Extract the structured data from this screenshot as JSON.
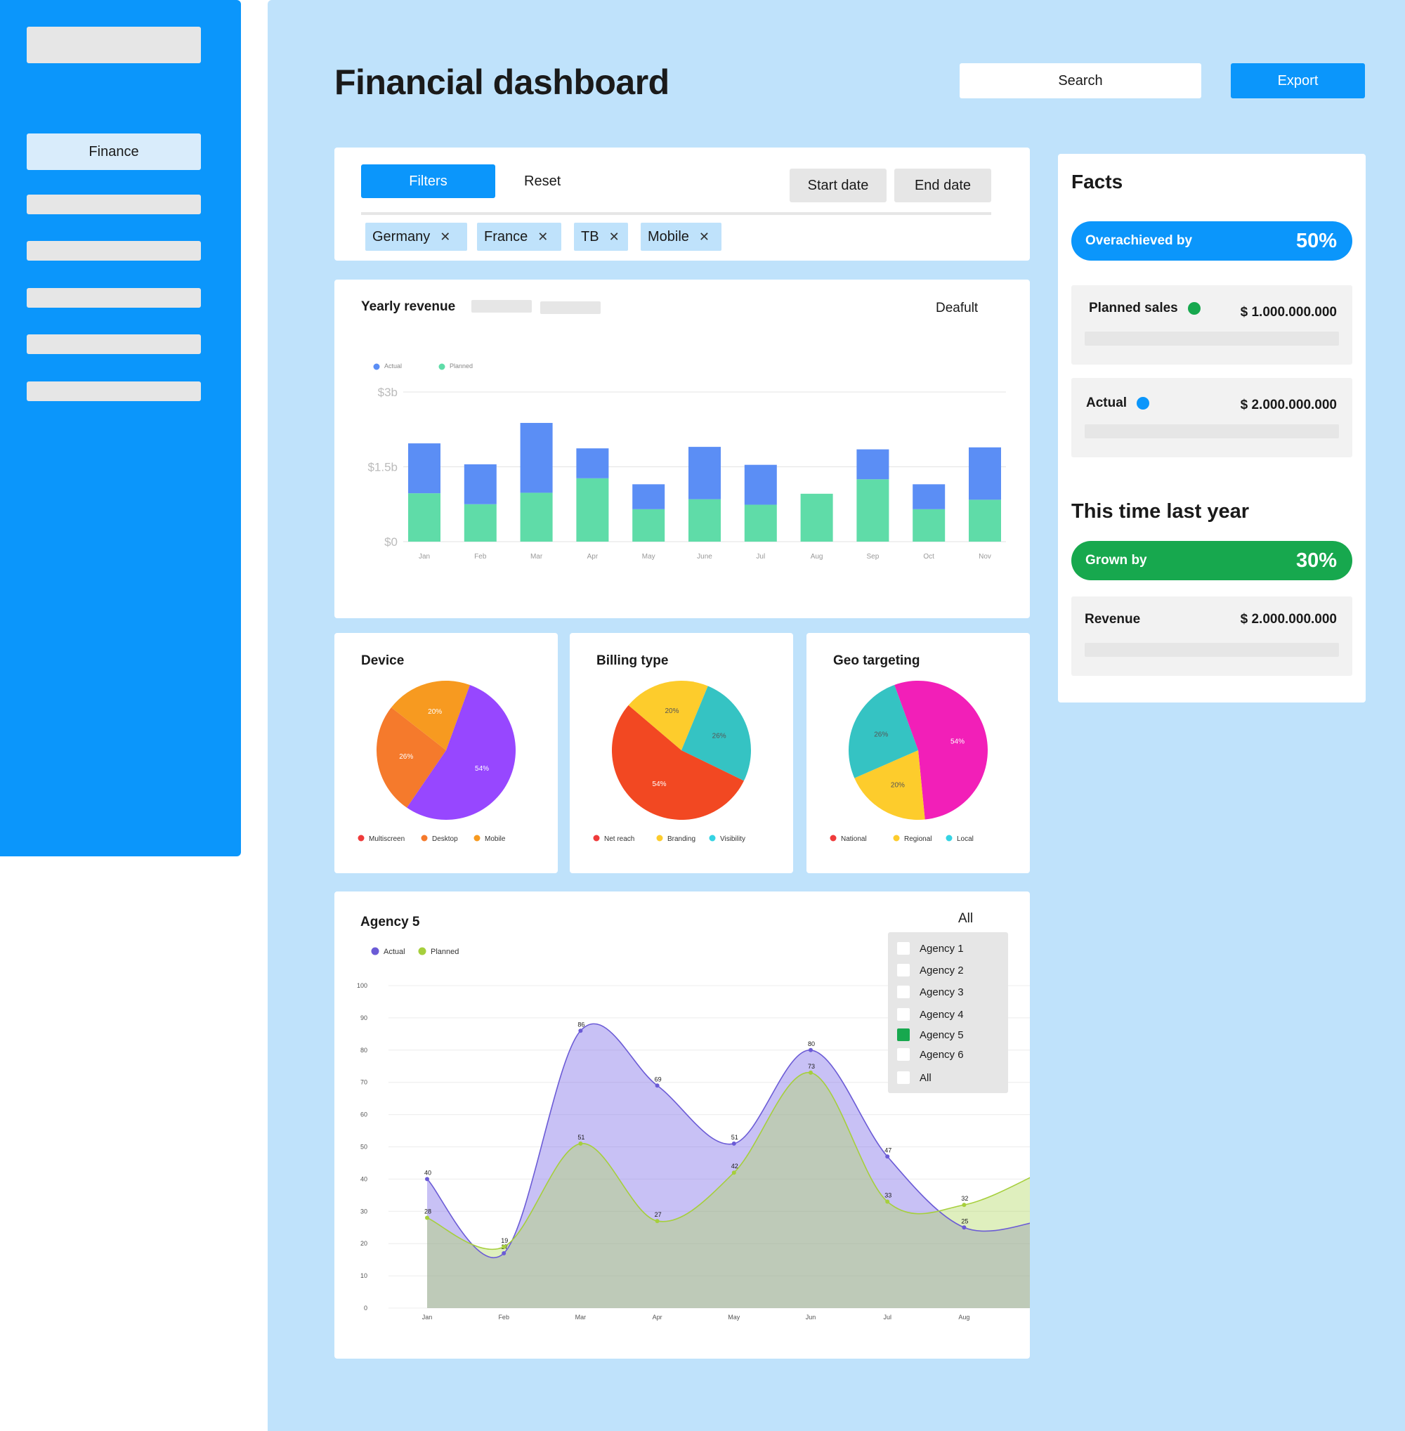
{
  "sidebar": {
    "items": [
      {
        "label": "Finance"
      }
    ]
  },
  "header": {
    "title": "Financial dashboard",
    "search_label": "Search",
    "export_label": "Export"
  },
  "filters": {
    "filters_label": "Filters",
    "reset_label": "Reset",
    "start_date_label": "Start date",
    "end_date_label": "End date",
    "chips": [
      "Germany",
      "France",
      "TB",
      "Mobile"
    ],
    "chip_remove_icon": "close-icon"
  },
  "revenue": {
    "title": "Yearly revenue",
    "view_label": "Deafult"
  },
  "agency": {
    "title": "Agency 5",
    "dropdown_label": "All",
    "options": [
      {
        "label": "Agency 1",
        "checked": false
      },
      {
        "label": "Agency 2",
        "checked": false
      },
      {
        "label": "Agency 3",
        "checked": false
      },
      {
        "label": "Agency 4",
        "checked": false
      },
      {
        "label": "Agency 5",
        "checked": true
      },
      {
        "label": "Agency 6",
        "checked": false
      },
      {
        "label": "All",
        "checked": false
      }
    ]
  },
  "facts": {
    "title": "Facts",
    "overachieved_label": "Overachieved by",
    "overachieved_value": "50%",
    "planned_label": "Planned sales",
    "planned_value": "$ 1.000.000.000",
    "actual_label": "Actual",
    "actual_value": "$ 2.000.000.000",
    "last_year_title": "This time last year",
    "grown_label": "Grown by",
    "grown_value": "30%",
    "revenue_label": "Revenue",
    "revenue_value": "$ 2.000.000.000"
  },
  "colors": {
    "primary": "#0b96fb",
    "background": "#bfe2fb",
    "green": "#17a84e",
    "bar_actual": "#5b8ef5",
    "bar_planned": "#5fdca8",
    "line_actual": "#6b5bd6",
    "line_planned": "#a6cf3c"
  },
  "chart_data": [
    {
      "type": "bar",
      "stacked": true,
      "categories": [
        "Jan",
        "Feb",
        "Mar",
        "Apr",
        "May",
        "June",
        "Jul",
        "Aug",
        "Sep",
        "Oct",
        "Nov"
      ],
      "series": [
        {
          "name": "Actual",
          "values": [
            1.0,
            0.8,
            1.4,
            0.6,
            0.5,
            1.05,
            0.8,
            0,
            0.6,
            0.5,
            1.05
          ]
        },
        {
          "name": "Planned",
          "values": [
            0.97,
            0.75,
            0.98,
            1.27,
            0.65,
            0.85,
            0.74,
            0.96,
            1.25,
            0.65,
            0.84
          ]
        }
      ],
      "ylim": [
        0,
        3
      ],
      "yticks": [
        "$0",
        "$1.5b",
        "$3b"
      ],
      "legend": "top-left",
      "grid": true
    },
    {
      "type": "pie",
      "title": "Device",
      "slices": [
        {
          "label": "Multiscreen",
          "value": 54,
          "text": "54%"
        },
        {
          "label": "Desktop",
          "value": 26,
          "text": "26%"
        },
        {
          "label": "Mobile",
          "value": 20,
          "text": "20%"
        }
      ],
      "slice_colors": [
        "#9747ff",
        "#f57a2c",
        "#f79a20"
      ],
      "legend_colors": [
        "#ef3b3b",
        "#f57a2c",
        "#f79a20"
      ]
    },
    {
      "type": "pie",
      "title": "Billing type",
      "slices": [
        {
          "label": "Net reach",
          "value": 54,
          "text": "54%"
        },
        {
          "label": "Branding",
          "value": 20,
          "text": "20%"
        },
        {
          "label": "Visibility",
          "value": 26,
          "text": "26%"
        }
      ],
      "slice_colors": [
        "#f24822",
        "#fdcc2c",
        "#35c3c3"
      ],
      "legend_colors": [
        "#ef3b3b",
        "#fdcc2c",
        "#35d3e3"
      ]
    },
    {
      "type": "pie",
      "title": "Geo targeting",
      "slices": [
        {
          "label": "National",
          "value": 54,
          "text": "54%"
        },
        {
          "label": "Regional",
          "value": 20,
          "text": "20%"
        },
        {
          "label": "Local",
          "value": 26,
          "text": "26%"
        }
      ],
      "slice_colors": [
        "#f21fb8",
        "#fdcc2c",
        "#35c3c3"
      ],
      "legend_colors": [
        "#ef3b3b",
        "#fdcc2c",
        "#35d3e3"
      ]
    },
    {
      "type": "area",
      "categories": [
        "Jan",
        "Feb",
        "Mar",
        "Apr",
        "May",
        "Jun",
        "Jul",
        "Aug"
      ],
      "series": [
        {
          "name": "Actual",
          "values": [
            40,
            17,
            86,
            69,
            51,
            80,
            47,
            25
          ]
        },
        {
          "name": "Planned",
          "values": [
            28,
            19,
            51,
            27,
            42,
            73,
            33,
            32
          ]
        }
      ],
      "ylim": [
        0,
        100
      ],
      "yticks": [
        0,
        10,
        20,
        30,
        40,
        50,
        60,
        70,
        80,
        90,
        100
      ],
      "legend": "top-left",
      "grid": true
    }
  ]
}
